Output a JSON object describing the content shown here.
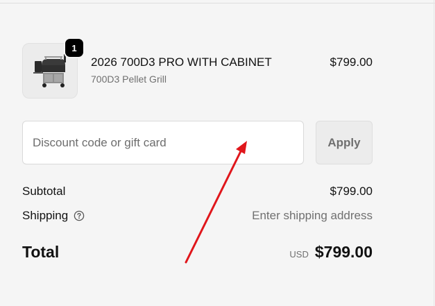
{
  "line_item": {
    "quantity": "1",
    "name": "2026 700D3 PRO WITH CABINET",
    "variant": "700D3 Pellet Grill",
    "price": "$799.00",
    "image_icon": "pellet-grill-icon"
  },
  "discount": {
    "placeholder": "Discount code or gift card",
    "value": "",
    "apply_label": "Apply"
  },
  "totals": {
    "subtotal_label": "Subtotal",
    "subtotal_value": "$799.00",
    "shipping_label": "Shipping",
    "shipping_value": "Enter shipping address",
    "total_label": "Total",
    "currency": "USD",
    "total_value": "$799.00"
  },
  "colors": {
    "background": "#f5f5f5",
    "badge": "#000000",
    "annotation_arrow": "#e0161b"
  }
}
